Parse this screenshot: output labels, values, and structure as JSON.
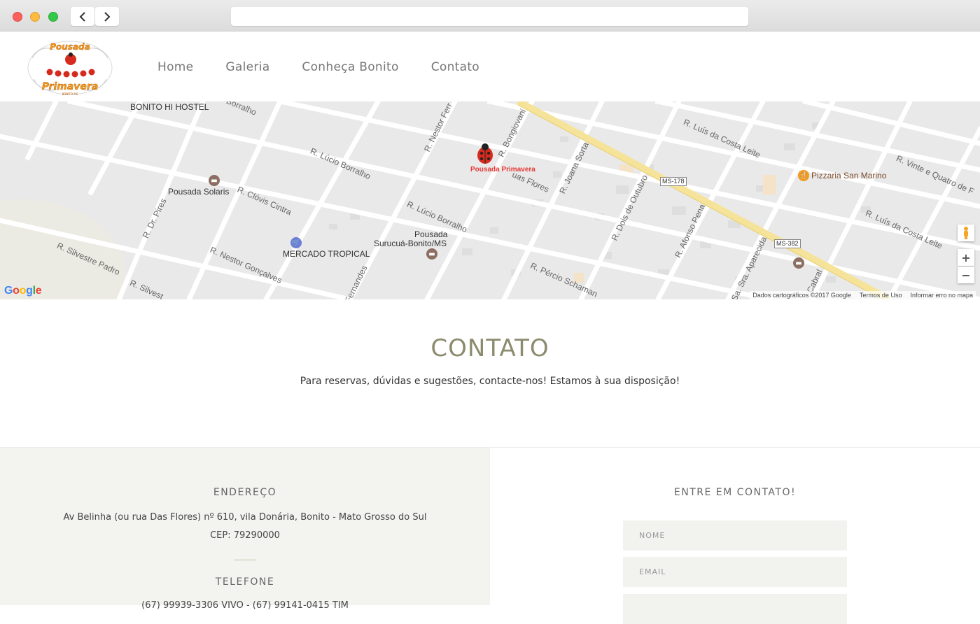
{
  "site": {
    "logo_text_top": "Pousada",
    "logo_text_bottom": "Primavera",
    "logo_text_small": "BONITO MS",
    "nav": [
      {
        "label": "Home"
      },
      {
        "label": "Galeria"
      },
      {
        "label": "Conheça Bonito"
      },
      {
        "label": "Contato"
      }
    ]
  },
  "map": {
    "labels": {
      "hostel": "BONITO HI HOSTEL",
      "solaris": "Pousada Solaris",
      "mercado": "MERCADO TROPICAL",
      "surucua": "Pousada\nSurucuá-Bonito/MS",
      "surucua_line1": "Pousada",
      "surucua_line2": "Surucuá-Bonito/MS",
      "pin": "Pousada Primavera",
      "pizzaria": "Pizzaria San Marino"
    },
    "streets": {
      "borralho_top": "io Borralho",
      "lucio1": "R. Lúcio Borralho",
      "lucio2": "R. Lúcio Borralho",
      "clovis": "R. Clóvis Cintra",
      "nestor_f": "R. Nestor Ferr",
      "bongiovani": "R. Bongiovani",
      "flores": "uas Flores",
      "joana": "R. Joana Sorta",
      "dois": "R. Dois de Outubro",
      "afonso": "R. Afonso Pena",
      "luis1": "R. Luís da Costa Leite",
      "luis2": "R. Luís da Costa Leite",
      "vinte": "R. Vinte e Quatro de F",
      "pires": "R. Dr. Pires",
      "silvestre1": "R. Silvestre Padro",
      "silvestre2": "R. Silvest",
      "nestor_g": "R. Nestor Gonçalves",
      "fernandes": "Fernandes",
      "percio": "R. Pércio Schaman",
      "aparecida": "Sa. Sra. Aparecida",
      "cabral": "Cabral",
      "ms178": "MS-178",
      "ms382": "MS-382"
    },
    "attribution": [
      "Dados cartográficos ©2017 Google",
      "Termos de Uso",
      "Informar erro no mapa"
    ],
    "google": "Google",
    "zoom_in": "+",
    "zoom_out": "−"
  },
  "contato": {
    "title": "CONTATO",
    "subtitle": "Para reservas, dúvidas e sugestões, contacte-nos! Estamos à sua disposição!"
  },
  "endereco": {
    "heading": "ENDEREÇO",
    "line1": "Av Belinha (ou rua Das Flores) nº 610, vila Donária, Bonito - Mato Grosso do Sul",
    "line2": "CEP: 79290000"
  },
  "telefone": {
    "heading": "TELEFONE",
    "line1": "(67) 99939-3306 VIVO - (67) 99141-0415 TIM"
  },
  "form": {
    "heading": "ENTRE EM CONTATO!",
    "nome_placeholder": "NOME",
    "email_placeholder": "EMAIL"
  },
  "colors": {
    "title": "#8c8b6e",
    "panel": "#f3f3f0",
    "pin": "#e53935",
    "highway": "#f6e39a"
  }
}
